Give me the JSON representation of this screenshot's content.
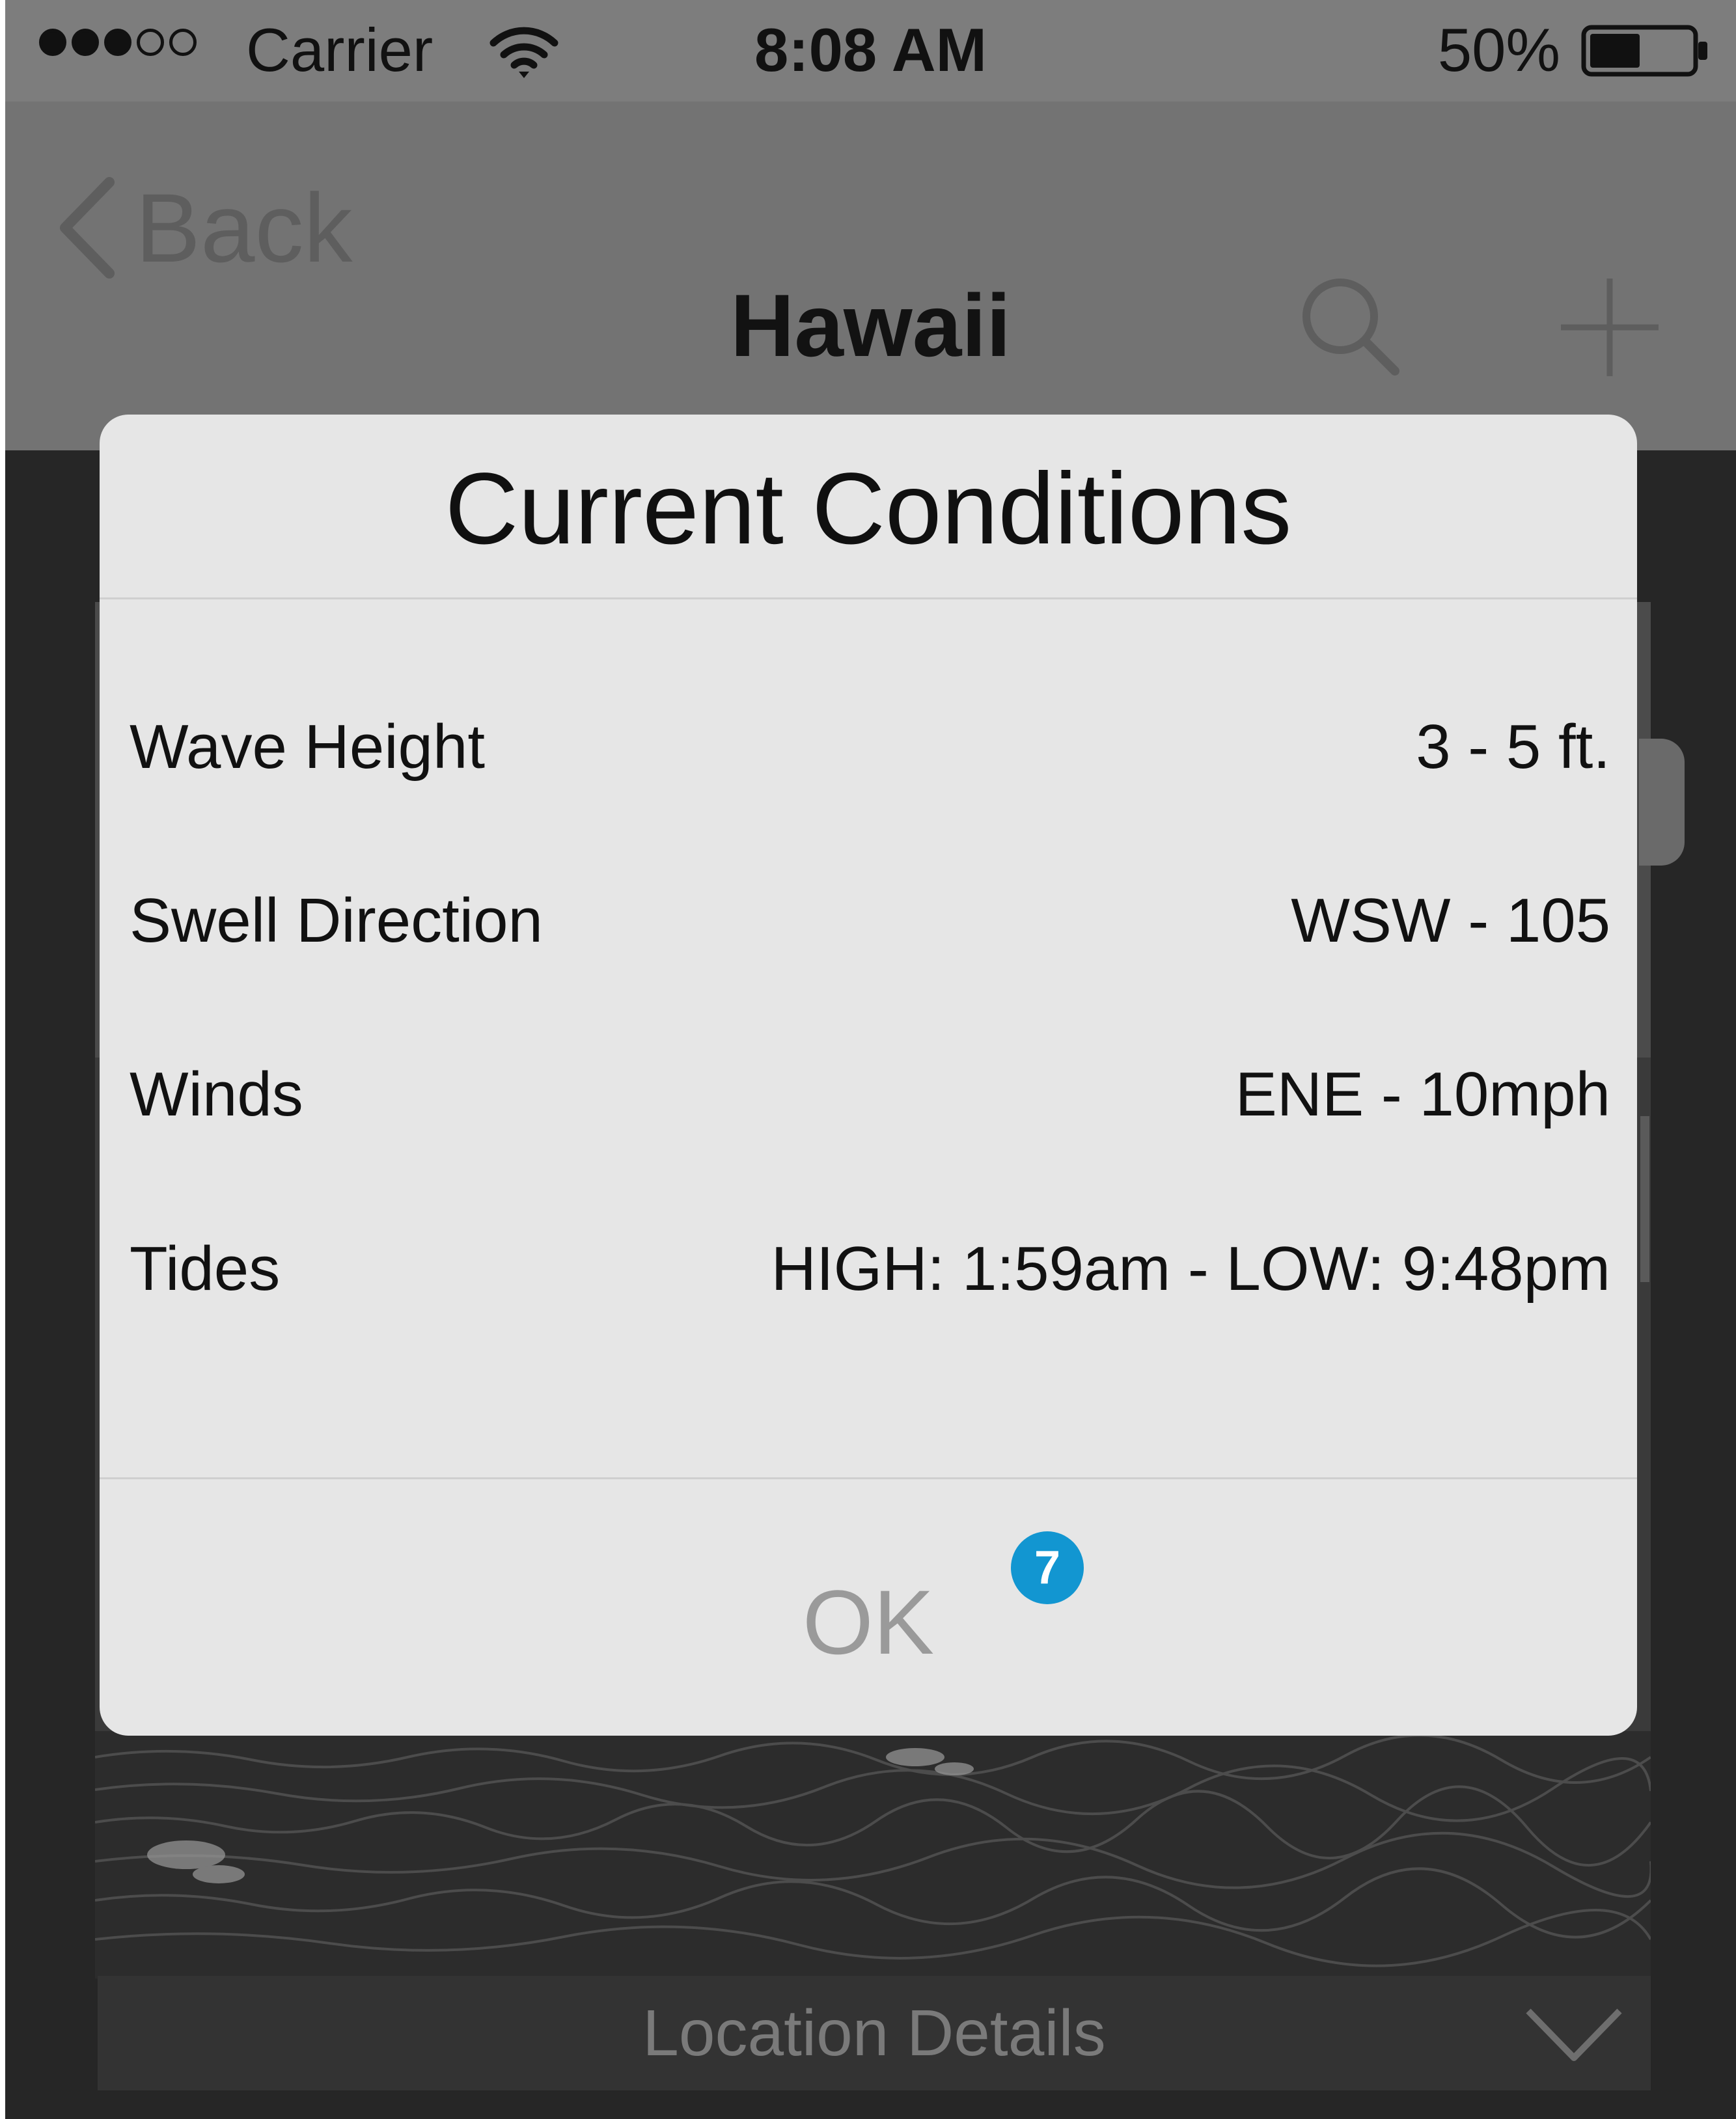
{
  "status_bar": {
    "signal_bars": 3,
    "signal_total": 5,
    "carrier": "Carrier",
    "time": "8:08 AM",
    "battery_percent": "50%",
    "battery_level": 0.5,
    "wifi_icon": "wifi-icon",
    "battery_icon": "battery-icon"
  },
  "nav_bar": {
    "back_label": "Back",
    "title": "Hawaii",
    "back_icon": "chevron-left-icon",
    "search_icon": "search-icon",
    "add_icon": "plus-icon"
  },
  "alert": {
    "title": "Current Conditions",
    "rows": [
      {
        "label": "Wave Height",
        "value": "3 - 5 ft."
      },
      {
        "label": "Swell Direction",
        "value": "WSW - 105"
      },
      {
        "label": "Winds",
        "value": "ENE - 10mph"
      },
      {
        "label": "Tides",
        "value": "HIGH: 1:59am - LOW: 9:48pm"
      }
    ],
    "ok_label": "OK",
    "badge": "7"
  },
  "footer": {
    "location_label": "Location Details",
    "chevron_icon": "chevron-down-icon"
  },
  "colors": {
    "status_bar_bg": "#7d7d7d",
    "nav_bar_bg": "#737373",
    "alert_bg": "#e6e6e6",
    "badge": "#1296d1",
    "ok_text": "#9a9a9a"
  }
}
